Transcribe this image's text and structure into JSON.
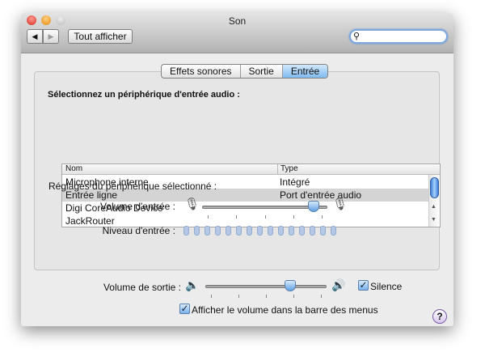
{
  "window": {
    "title": "Son",
    "show_all": "Tout afficher",
    "search_placeholder": ""
  },
  "tabs": [
    {
      "label": "Effets sonores",
      "selected": false
    },
    {
      "label": "Sortie",
      "selected": false
    },
    {
      "label": "Entrée",
      "selected": true
    }
  ],
  "input": {
    "heading": "Sélectionnez un périphérique d'entrée audio :",
    "columns": [
      "Nom",
      "Type"
    ],
    "devices": [
      {
        "name": "Microphone interne",
        "type": "Intégré"
      },
      {
        "name": "Entrée ligne",
        "type": "Port d'entrée audio",
        "selected": true
      },
      {
        "name": "Digi CoreAudio Device",
        "type": ""
      },
      {
        "name": "JackRouter",
        "type": ""
      }
    ],
    "settings_label": "Réglages du périphérique sélectionné :",
    "volume_label": "Volume d'entrée :",
    "volume_value": 0.93,
    "level_label": "Niveau d'entrée :",
    "level_segments": 15,
    "level_active": 0
  },
  "output": {
    "volume_label": "Volume de sortie :",
    "volume_value": 0.72,
    "mute_label": "Silence",
    "mute_checked": true,
    "menubar_label": "Afficher le volume dans la barre des menus",
    "menubar_checked": true
  },
  "help": "?",
  "colors": {
    "accent": "#6aaaea",
    "close": "#e0443c",
    "minimize": "#f0a030"
  }
}
